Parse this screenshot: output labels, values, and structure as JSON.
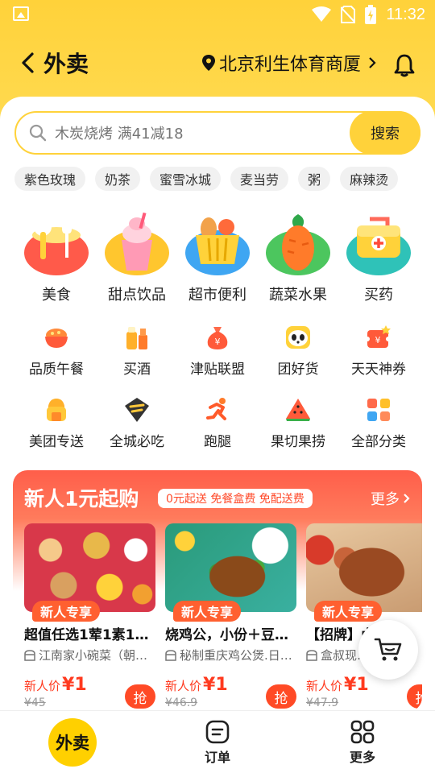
{
  "status": {
    "time": "11:32"
  },
  "header": {
    "title": "外卖",
    "location": "北京利生体育商厦"
  },
  "search": {
    "placeholder": "木炭烧烤 满41减18",
    "button": "搜索"
  },
  "tags": [
    "紫色玫瑰",
    "奶茶",
    "蜜雪冰城",
    "麦当劳",
    "粥",
    "麻辣烫"
  ],
  "big_categories": [
    {
      "label": "美食",
      "icon": "food-icon"
    },
    {
      "label": "甜点饮品",
      "icon": "dessert-icon"
    },
    {
      "label": "超市便利",
      "icon": "supermarket-icon"
    },
    {
      "label": "蔬菜水果",
      "icon": "vegetable-icon"
    },
    {
      "label": "买药",
      "icon": "medicine-icon"
    }
  ],
  "small_categories_row1": [
    {
      "label": "品质午餐",
      "icon": "lunch-icon"
    },
    {
      "label": "买酒",
      "icon": "beer-icon"
    },
    {
      "label": "津贴联盟",
      "icon": "money-bag-icon"
    },
    {
      "label": "团好货",
      "icon": "panda-icon"
    },
    {
      "label": "天天神券",
      "icon": "coupon-icon"
    }
  ],
  "small_categories_row2": [
    {
      "label": "美团专送",
      "icon": "delivery-icon"
    },
    {
      "label": "全城必吃",
      "icon": "diamond-icon"
    },
    {
      "label": "跑腿",
      "icon": "runner-icon"
    },
    {
      "label": "果切果捞",
      "icon": "watermelon-icon"
    },
    {
      "label": "全部分类",
      "icon": "grid-icon"
    }
  ],
  "promo": {
    "title": "新人1元起购",
    "subtitle": "0元起送 免餐盒费 免配送费",
    "more": "更多",
    "products": [
      {
        "badge": "新人专享",
        "name": "超值任选1荤1素1…",
        "shop": "江南家小碗菜（朝…",
        "price_label": "新人价",
        "price": "¥1",
        "original": "¥45",
        "grab": "抢"
      },
      {
        "badge": "新人专享",
        "name": "烧鸡公，小份＋豆…",
        "shop": "秘制重庆鸡公煲.日…",
        "price_label": "新人价",
        "price": "¥1",
        "original": "¥46.9",
        "grab": "抢"
      },
      {
        "badge": "新人专享",
        "name": "【招牌】卤肉牛…",
        "shop": "盒叔现…",
        "price_label": "新人价",
        "price": "¥1",
        "original": "¥47.9",
        "grab": "抢"
      }
    ]
  },
  "nav": {
    "home": "外卖",
    "orders": "订单",
    "more": "更多"
  },
  "colors": {
    "brand_yellow": "#ffd23a",
    "promo_red": "#ff5e4a",
    "price_red": "#ff3a1f"
  }
}
